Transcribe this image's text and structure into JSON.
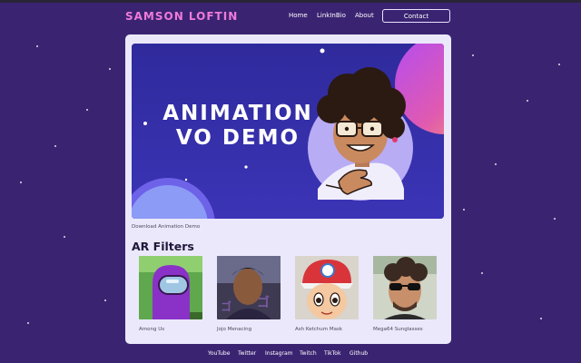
{
  "header": {
    "brand": "SAMSON LOFTIN",
    "nav": [
      {
        "label": "Home"
      },
      {
        "label": "LinkInBio"
      },
      {
        "label": "About"
      }
    ],
    "contact_label": "Contact"
  },
  "hero": {
    "title_line1": "ANIMATION",
    "title_line2": "VO DEMO",
    "link_label": "Download Animation Demo"
  },
  "ar_filters": {
    "title": "AR Filters",
    "items": [
      {
        "label": "Among Us"
      },
      {
        "label": "Jojo Menacing"
      },
      {
        "label": "Ash Ketchum Mask"
      },
      {
        "label": "Mega64 Sunglasses"
      }
    ]
  },
  "footer": {
    "links": [
      {
        "label": "YouTube"
      },
      {
        "label": "Twitter"
      },
      {
        "label": "Instagram"
      },
      {
        "label": "Twitch"
      },
      {
        "label": "TikTok"
      },
      {
        "label": "Github"
      }
    ]
  },
  "colors": {
    "background": "#3a2472",
    "brand": "#f07ad9",
    "card": "#ebe8fc",
    "hero_bg": "#3328a0"
  }
}
